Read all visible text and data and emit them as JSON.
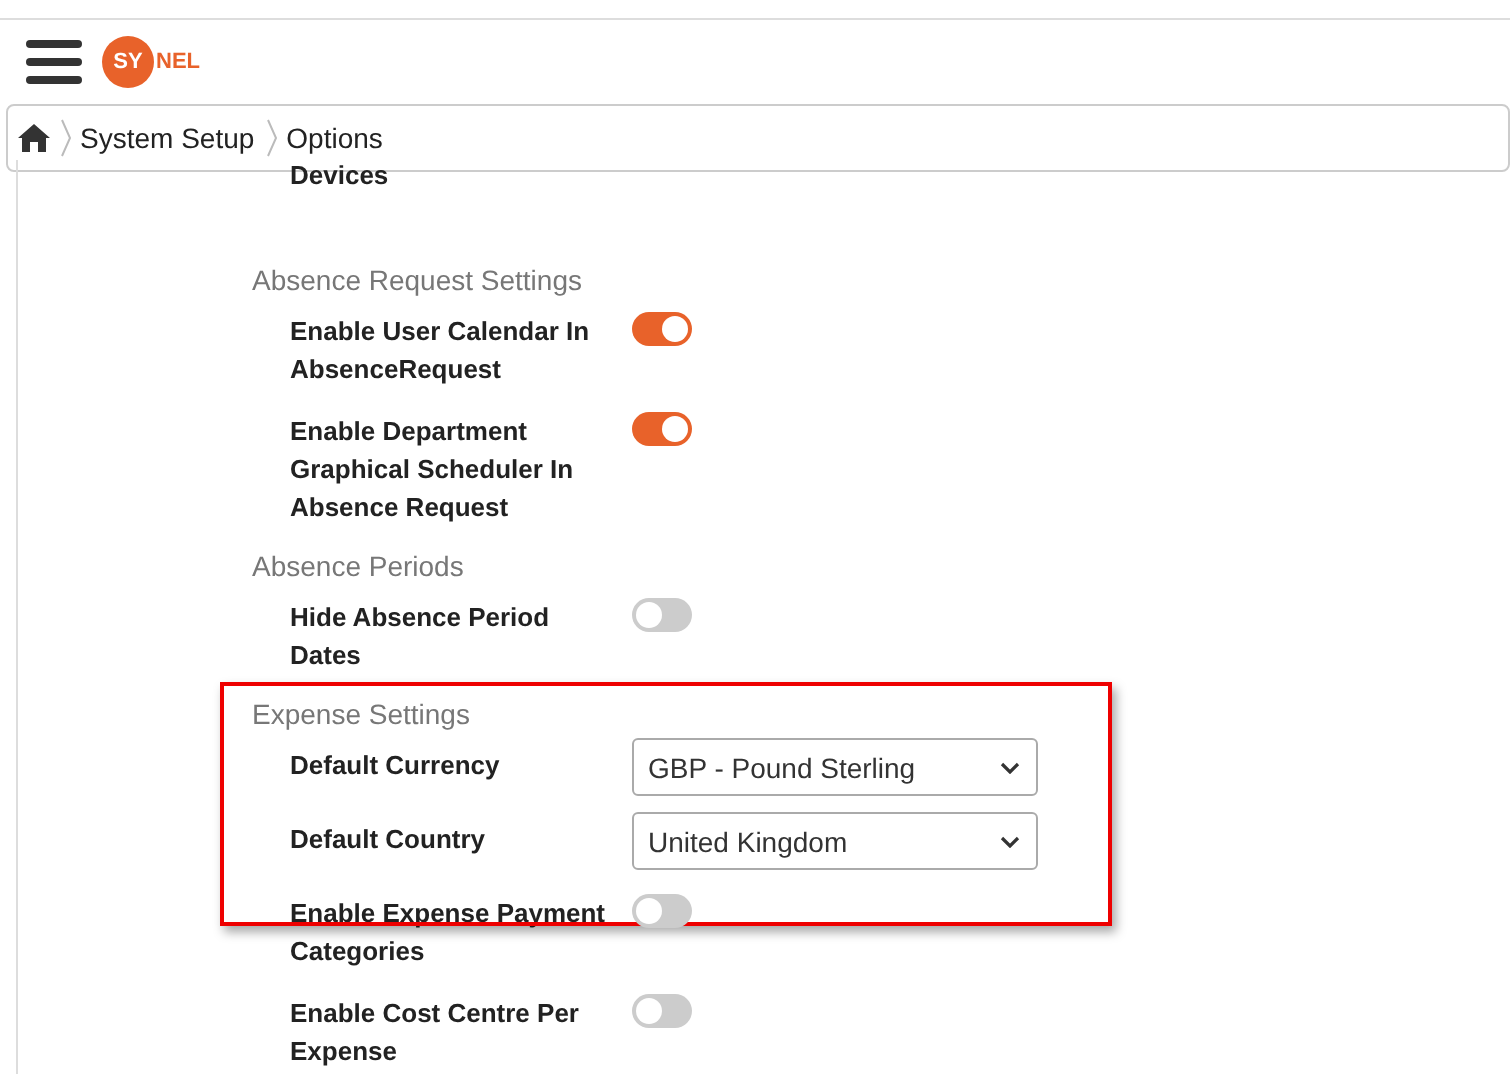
{
  "header": {
    "logo": {
      "mark": "SY",
      "rest": "NEL"
    }
  },
  "breadcrumb": [
    {
      "label": "System Setup"
    },
    {
      "label": "Options"
    }
  ],
  "top_label": "Devices",
  "sections": [
    {
      "title": "Absence Request Settings",
      "highlighted": false,
      "items": [
        {
          "kind": "toggle",
          "label": "Enable User Calendar In AbsenceRequest",
          "on": true
        },
        {
          "kind": "toggle",
          "label": "Enable Department Graphical Scheduler In Absence Request",
          "on": true
        }
      ]
    },
    {
      "title": "Absence Periods",
      "highlighted": false,
      "items": [
        {
          "kind": "toggle",
          "label": "Hide Absence Period Dates",
          "on": false
        }
      ]
    },
    {
      "title": "Expense Settings",
      "highlighted": true,
      "items": [
        {
          "kind": "select",
          "label": "Default Currency",
          "value": "GBP - Pound Sterling"
        },
        {
          "kind": "select",
          "label": "Default Country",
          "value": "United Kingdom"
        },
        {
          "kind": "toggle",
          "label": "Enable Expense Payment Categories",
          "on": false
        },
        {
          "kind": "toggle",
          "label": "Enable Cost Centre Per Expense",
          "on": false
        }
      ]
    }
  ]
}
